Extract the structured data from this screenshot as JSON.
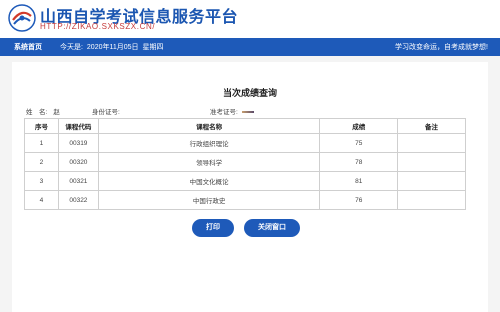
{
  "header": {
    "title": "山西自学考试信息服务平台",
    "url": "HTTP://ZIKAO.SXKSZX.CN/"
  },
  "nav": {
    "home": "系统首页",
    "today_label": "今天是:",
    "date": "2020年11月05日",
    "weekday": "星期四",
    "slogan": "学习改变命运，自考成就梦想!"
  },
  "page": {
    "heading": "当次成绩查询",
    "name_label": "姓　名:",
    "name_value": "赵",
    "id_label": "身份证号:",
    "ticket_label": "准考证号:"
  },
  "table": {
    "headers": [
      "序号",
      "课程代码",
      "课程名称",
      "成绩",
      "备注"
    ],
    "rows": [
      [
        "1",
        "00319",
        "行政组织理论",
        "75",
        ""
      ],
      [
        "2",
        "00320",
        "领导科学",
        "78",
        ""
      ],
      [
        "3",
        "00321",
        "中国文化概论",
        "81",
        ""
      ],
      [
        "4",
        "00322",
        "中国行政史",
        "76",
        ""
      ]
    ]
  },
  "buttons": {
    "print": "打印",
    "close": "关闭窗口"
  },
  "colors": {
    "brand_blue": "#1e5ab9",
    "url_red": "#c63b3b"
  }
}
